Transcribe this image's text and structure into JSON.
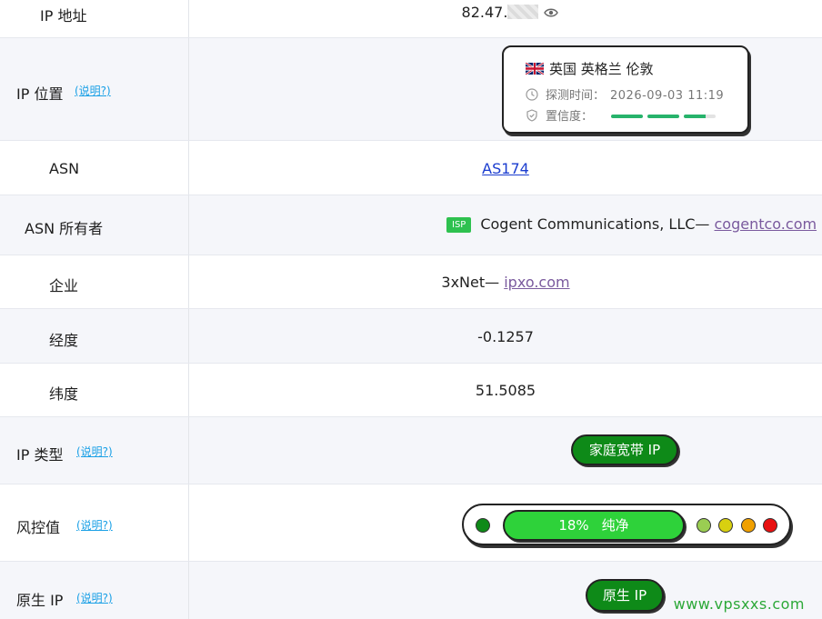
{
  "rows": {
    "ip_address": {
      "label": "IP 地址",
      "value_prefix": "82.47."
    },
    "ip_location": {
      "label": "IP 位置",
      "help": "(说明?)",
      "card": {
        "place": "英国 英格兰 伦敦",
        "probe_label": "探测时间：",
        "probe_time": "2026-09-03 11:19",
        "confidence_label": "置信度：",
        "confidence_level": 0.9
      }
    },
    "asn": {
      "label": "ASN",
      "value": "AS174"
    },
    "asn_owner": {
      "label": "ASN 所有者",
      "badge": "ISP",
      "name": "Cogent Communications, LLC—",
      "domain": "cogentco.com"
    },
    "company": {
      "label": "企业",
      "name": "3xNet—",
      "domain": "ipxo.com"
    },
    "longitude": {
      "label": "经度",
      "value": "-0.1257"
    },
    "latitude": {
      "label": "纬度",
      "value": "51.5085"
    },
    "ip_type": {
      "label": "IP 类型",
      "help": "(说明?)",
      "value": "家庭宽带 IP"
    },
    "risk": {
      "label": "风控值",
      "help": "(说明?)",
      "value": "18%",
      "status": "纯净",
      "level": 0.18
    },
    "native_ip": {
      "label": "原生 IP",
      "help": "(说明?)",
      "value": "原生 IP"
    }
  },
  "colors": {
    "pill_green": "#0e8a18",
    "risk_green": "#2ed23a",
    "link_blue": "#1a3ccf",
    "help_blue": "#1aa0e6"
  },
  "icons": {
    "eye": "eye-icon",
    "flag": "uk-flag-icon",
    "clock": "clock-icon",
    "shield": "shield-icon"
  },
  "watermark": "www.vpsxxs.com"
}
